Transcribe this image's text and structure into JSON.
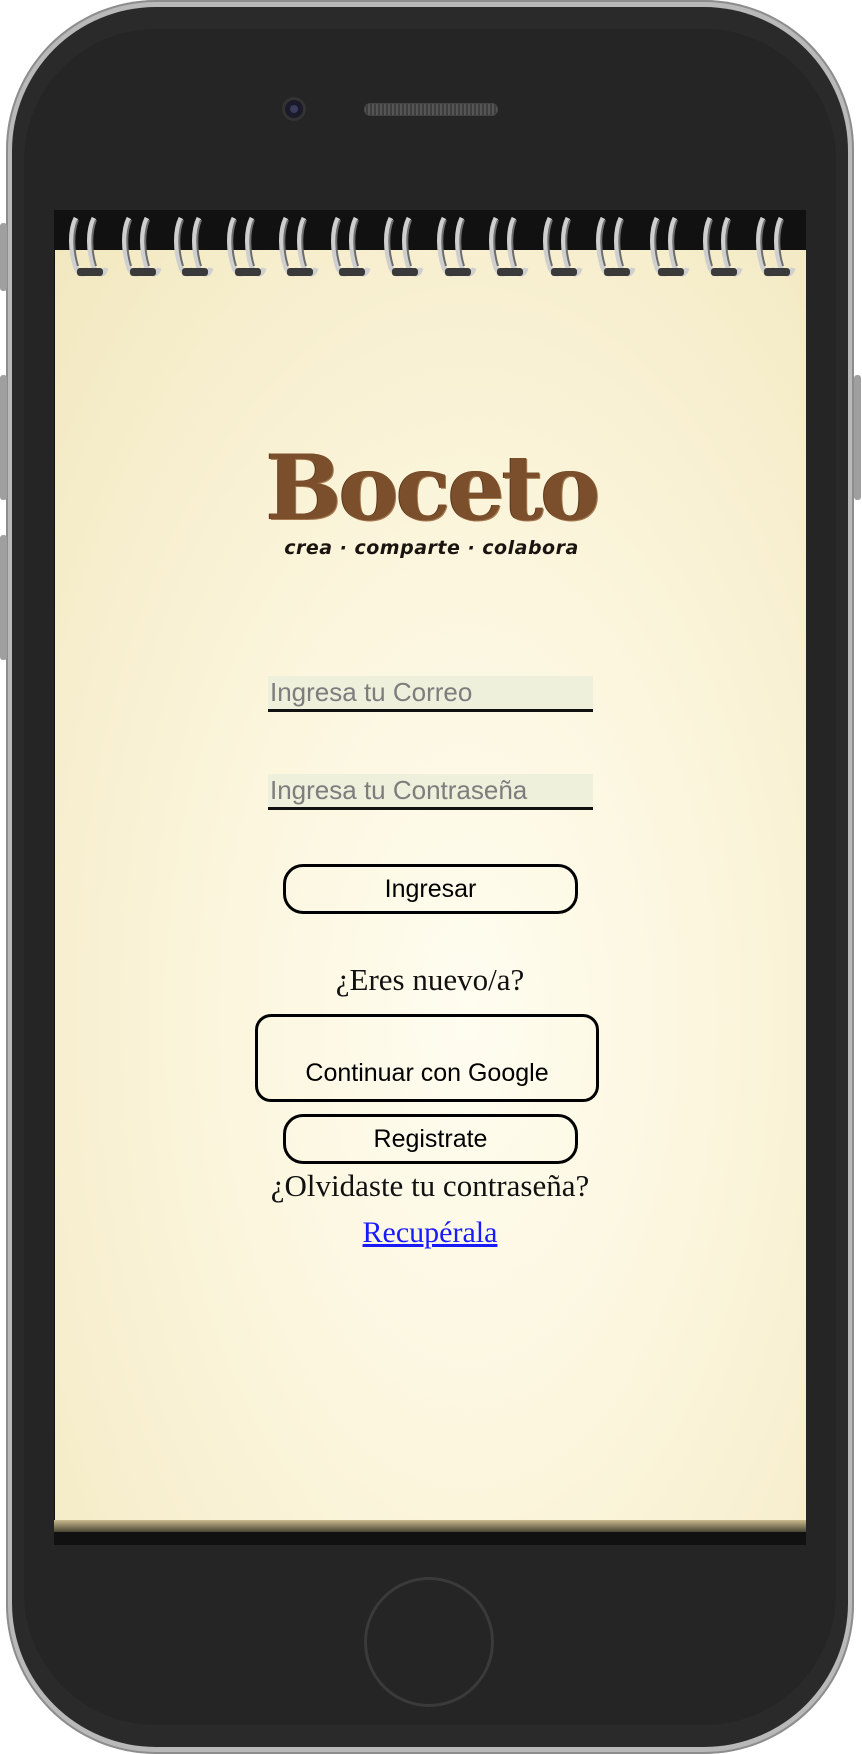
{
  "app": {
    "logo_title": "Boceto",
    "logo_tagline": "crea · comparte · colabora"
  },
  "login": {
    "email_placeholder": "Ingresa tu Correo",
    "password_placeholder": "Ingresa tu Contraseña",
    "submit_label": "Ingresar"
  },
  "signup": {
    "prompt": "¿Eres nuevo/a?",
    "google_label": "Continuar con Google",
    "register_label": "Registrate"
  },
  "recovery": {
    "prompt": "¿Olvidaste tu contraseña?",
    "link_label": "Recupérala"
  },
  "colors": {
    "paper": "#fbf5dc",
    "logo_brown": "#7b4f2c",
    "link_blue": "#1a1aff",
    "phone_body": "#252525"
  }
}
